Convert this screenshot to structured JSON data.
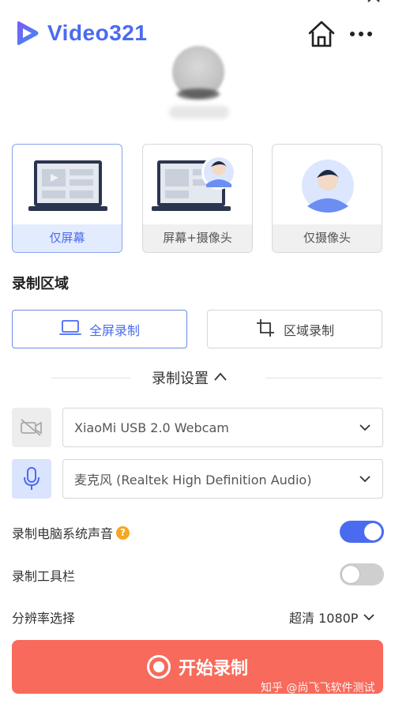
{
  "app": {
    "logo_text": "Video321",
    "brand_color": "#4a6bf0",
    "icons": [
      "logo-icon",
      "home-icon",
      "more-icon",
      "close-icon"
    ]
  },
  "modes": [
    {
      "label": "仅屏幕",
      "active": true,
      "icon": "laptop-screen-icon"
    },
    {
      "label": "屏幕+摄像头",
      "active": false,
      "icon": "laptop-camera-icon"
    },
    {
      "label": "仅摄像头",
      "active": false,
      "icon": "camera-person-icon"
    }
  ],
  "region": {
    "title": "录制区域",
    "fullscreen_label": "全屏录制",
    "area_label": "区域录制"
  },
  "settings": {
    "header": "录制设置",
    "camera_value": "XiaoMi USB 2.0 Webcam",
    "mic_value": "麦克风 (Realtek High Definition Audio)",
    "system_audio_label": "录制电脑系统声音",
    "system_audio_on": true,
    "toolbar_label": "录制工具栏",
    "toolbar_on": false,
    "resolution_label": "分辨率选择",
    "resolution_value": "超清 1080P",
    "help_glyph": "?"
  },
  "start_label": "开始录制",
  "start_color": "#f86a5b",
  "watermark": "知乎 @尚飞飞软件测试"
}
